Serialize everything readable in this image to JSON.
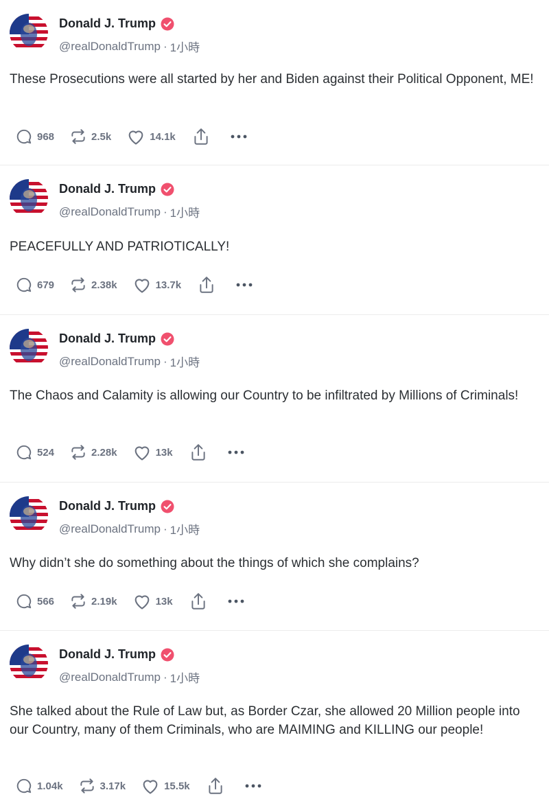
{
  "author": {
    "display_name": "Donald J. Trump",
    "handle": "@realDonaldTrump",
    "separator": "·",
    "verified_icon": "verified-badge-icon",
    "verified_color": "#f0506e"
  },
  "theme": {
    "muted": "#6b7280",
    "text": "#1f2328",
    "divider": "#ececec"
  },
  "posts": [
    {
      "timestamp": "1小時",
      "text": "These Prosecutions were all started by her and Biden against their Political Opponent, ME!",
      "replies": "968",
      "retruths": "2.5k",
      "likes": "14.1k"
    },
    {
      "timestamp": "1小時",
      "text": "PEACEFULLY AND PATRIOTICALLY!",
      "replies": "679",
      "retruths": "2.38k",
      "likes": "13.7k"
    },
    {
      "timestamp": "1小時",
      "text": "The Chaos and Calamity is allowing our Country to be infiltrated by Millions of Criminals!",
      "replies": "524",
      "retruths": "2.28k",
      "likes": "13k"
    },
    {
      "timestamp": "1小時",
      "text": "Why didn’t she do something about the things of which she complains?",
      "replies": "566",
      "retruths": "2.19k",
      "likes": "13k"
    },
    {
      "timestamp": "1小時",
      "text": "She talked about the Rule of Law but, as Border Czar, she allowed 20 Million people into our Country, many of them Criminals, who are MAIMING and KILLING our people!",
      "replies": "1.04k",
      "retruths": "3.17k",
      "likes": "15.5k"
    }
  ]
}
